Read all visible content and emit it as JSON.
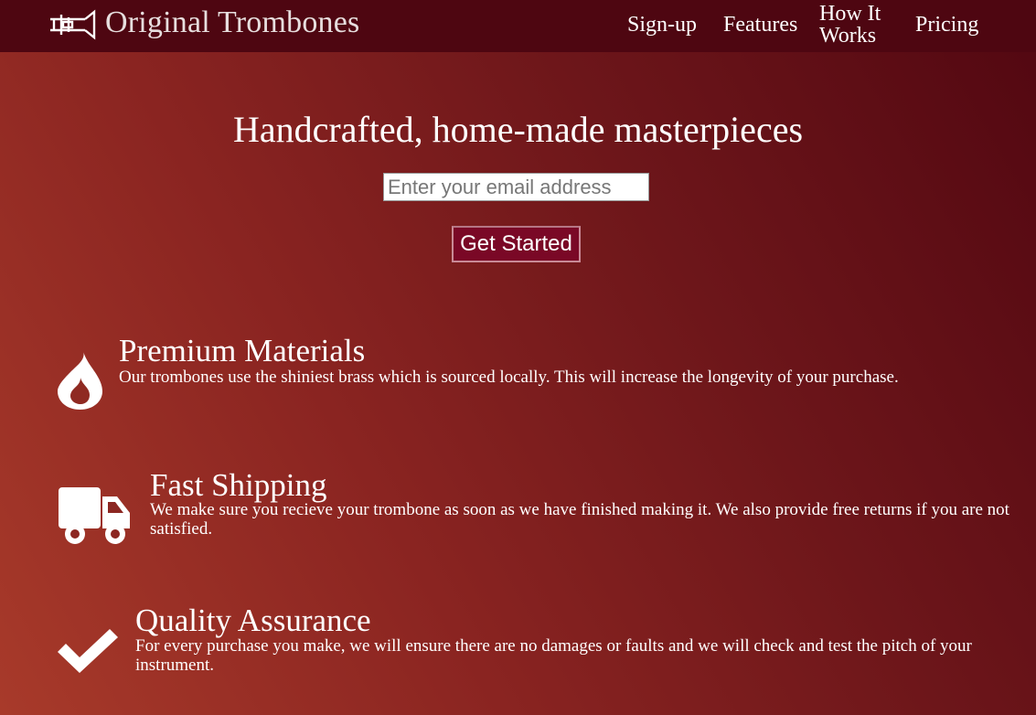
{
  "brand": {
    "logo_icon": "trombone-icon",
    "name": "Original Trombones"
  },
  "nav": {
    "items": [
      {
        "label": "Sign-up"
      },
      {
        "label": "Features"
      },
      {
        "label": "How It Works"
      },
      {
        "label": "Pricing"
      }
    ]
  },
  "hero": {
    "title": "Handcrafted, home-made masterpieces",
    "email_placeholder": "Enter your email address",
    "button_label": "Get Started"
  },
  "features": [
    {
      "icon": "flame-icon",
      "title": "Premium Materials",
      "text": "Our trombones use the shiniest brass which is sourced locally. This will increase the longevity of your purchase."
    },
    {
      "icon": "truck-icon",
      "title": "Fast Shipping",
      "text": "We make sure you recieve your trombone as soon as we have finished making it. We also provide free returns if you are not satisfied."
    },
    {
      "icon": "checkmark-icon",
      "title": "Quality Assurance",
      "text": "For every purchase you make, we will ensure there are no damages or faults and we will check and test the pitch of your instrument."
    }
  ],
  "colors": {
    "header_bg": "#4e0611",
    "button_bg": "#7a0826",
    "gradient_light": "#a83a2a",
    "gradient_dark": "#520711"
  }
}
